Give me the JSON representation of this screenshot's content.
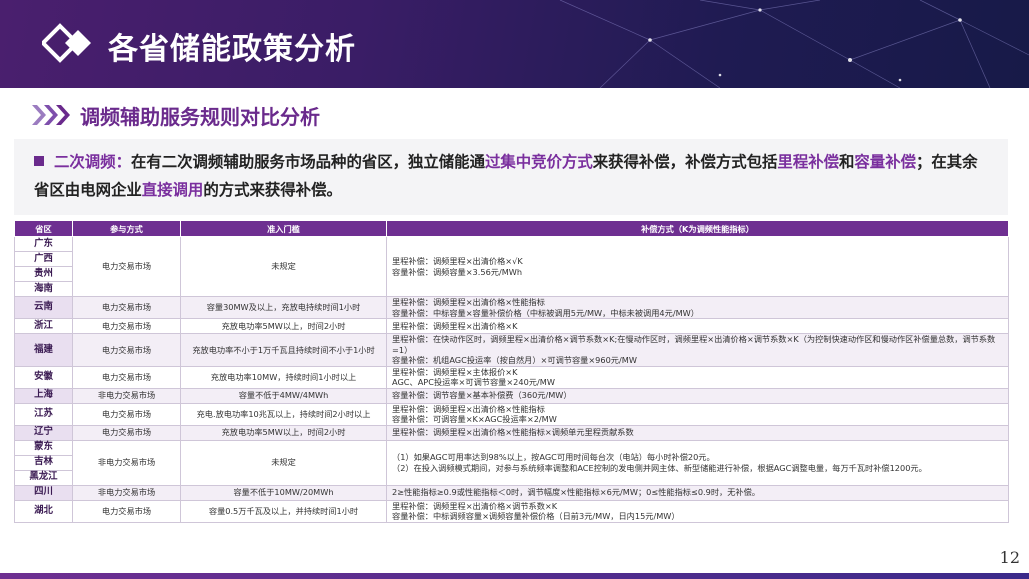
{
  "header": {
    "title": "各省储能政策分析",
    "colors": {
      "banner_start": "#4a1f6e",
      "banner_end": "#171a48",
      "accent": "#6e2f91"
    }
  },
  "section": {
    "icon": "triple-chevron-icon",
    "title": "调频辅助服务规则对比分析"
  },
  "description": {
    "lead": "二次调频：",
    "t1": "在有二次调频辅助服务市场品种的省区，独立储能通",
    "h1": "过集中竞价方式",
    "t2": "来获得补偿，补偿方式包括",
    "h2": "里程补偿",
    "t3": "和",
    "h3": "容量补偿",
    "t4": "；在其余省区由电网企业",
    "h4": "直接调用",
    "t5": "的方式来获得补偿。"
  },
  "table": {
    "headers": [
      "省区",
      "参与方式",
      "准入门槛",
      "补偿方式（K为调频性能指标）"
    ],
    "g1": {
      "provinces": [
        "广东",
        "广西",
        "贵州",
        "海南"
      ],
      "mode": "电力交易市场",
      "threshold": "未规定",
      "comp": [
        "里程补偿：调频里程×出清价格×√K",
        "容量补偿：调频容量×3.56元/MWh"
      ]
    },
    "r_yunnan": {
      "province": "云南",
      "mode": "电力交易市场",
      "threshold": "容量30MW及以上，充放电持续时间1小时",
      "comp": [
        "里程补偿：调频里程×出清价格×性能指标",
        "容量补偿：中标容量×容量补偿价格（中标被调用5元/MW，中标未被调用4元/MW）"
      ]
    },
    "r_zhejiang": {
      "province": "浙江",
      "mode": "电力交易市场",
      "threshold": "充放电功率5MW以上，时间2小时",
      "comp": [
        "里程补偿：调频里程×出清价格×K"
      ]
    },
    "r_fujian": {
      "province": "福建",
      "mode": "电力交易市场",
      "threshold": "充放电功率不小于1万千瓦且持续时间不小于1小时",
      "comp": [
        "里程补偿：在快动作区时，调频里程×出清价格×调节系数×K;在慢动作区时，调频里程×出清价格×调节系数×K（为控制快速动作区和慢动作区补偿量总数，调节系数=1）",
        "容量补偿：机组AGC投运率（按自然月）×可调节容量×960元/MW"
      ]
    },
    "r_anhui": {
      "province": "安徽",
      "mode": "电力交易市场",
      "threshold": "充放电功率10MW，持续时间1小时以上",
      "comp": [
        "里程补偿：调频里程×主体报价×K",
        "AGC、APC投运率×可调节容量×240元/MW"
      ]
    },
    "r_shanghai": {
      "province": "上海",
      "mode": "非电力交易市场",
      "threshold": "容量不低于4MW/4MWh",
      "comp": [
        "容量补偿：调节容量×基本补偿费（360元/MW）"
      ]
    },
    "r_jiangsu": {
      "province": "江苏",
      "mode": "电力交易市场",
      "threshold": "充电.放电功率10兆瓦以上，持续时间2小时以上",
      "comp": [
        "里程补偿：调频里程×出清价格×性能指标",
        "容量补偿：可调容量×K×AGC投运率×2/MW"
      ]
    },
    "r_liaoning": {
      "province": "辽宁",
      "mode": "电力交易市场",
      "threshold": "充放电功率5MW以上，时间2小时",
      "comp": [
        "里程补偿：调频里程×出清价格×性能指标×调频单元里程贡献系数"
      ]
    },
    "g2": {
      "provinces": [
        "蒙东",
        "吉林",
        "黑龙江"
      ],
      "mode": "非电力交易市场",
      "threshold": "未规定",
      "comp": [
        "（1）如果AGC可用率达到98%以上，按AGC可用时间每台次（电站）每小时补偿20元。",
        "（2）在投入调频模式期间，对参与系统频率调整和ACE控制的发电侧并网主体、新型储能进行补偿，根据AGC调整电量，每万千瓦时补偿1200元。"
      ]
    },
    "r_sichuan": {
      "province": "四川",
      "mode": "非电力交易市场",
      "threshold": "容量不低于10MW/20MWh",
      "comp": [
        "2≥性能指标≥0.9或性能指标＜0时，调节幅度×性能指标×6元/MW；0≤性能指标≤0.9时，无补偿。"
      ]
    },
    "r_hubei": {
      "province": "湖北",
      "mode": "电力交易市场",
      "threshold": "容量0.5万千瓦及以上，并持续时间1小时",
      "comp": [
        "里程补偿：调频里程×出清价格×调节系数×K",
        "容量补偿：中标调频容量×调频容量补偿价格（日前3元/MW，日内15元/MW）"
      ]
    }
  },
  "page_number": "12"
}
